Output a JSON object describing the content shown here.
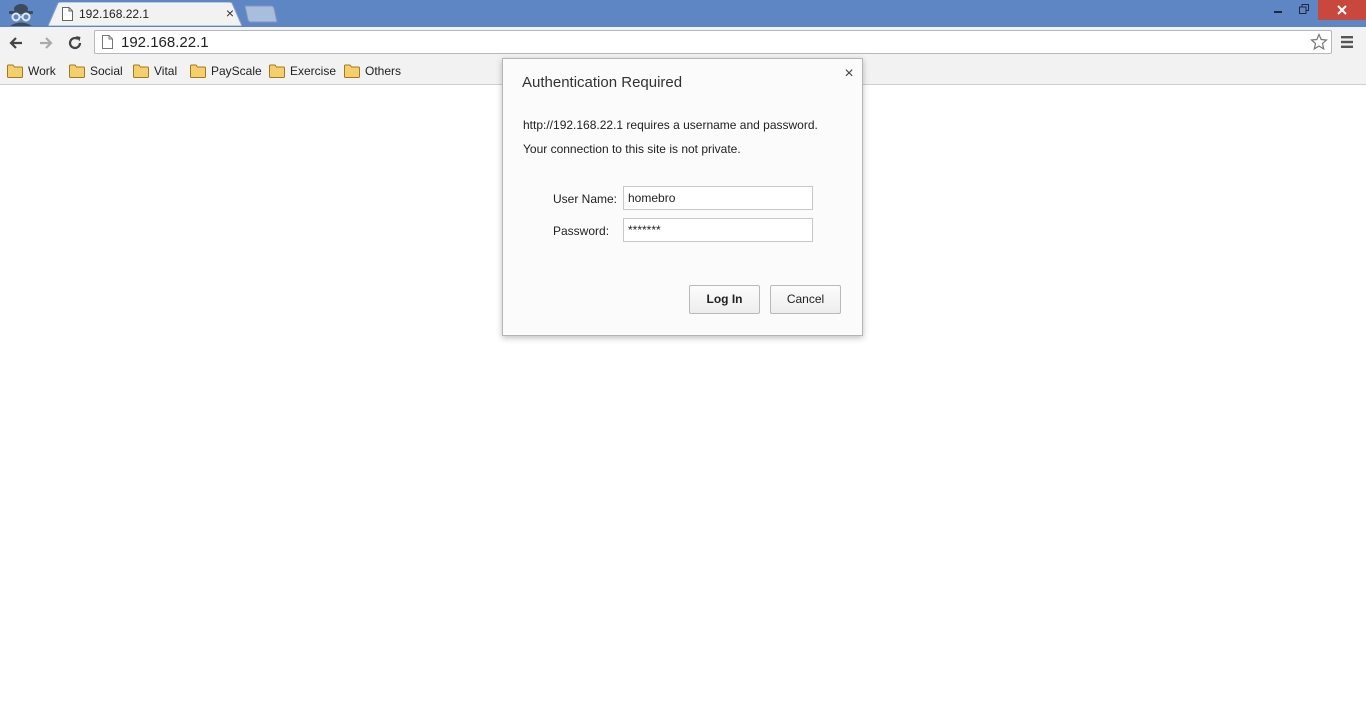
{
  "browser": {
    "tab": {
      "title": "192.168.22.1",
      "close_glyph": "×"
    },
    "url": "192.168.22.1",
    "icons": {
      "incognito": "incognito-icon",
      "back": "back-arrow-icon",
      "forward": "forward-arrow-icon",
      "reload": "reload-icon",
      "star": "star-icon",
      "menu": "hamburger-menu-icon"
    },
    "colors": {
      "titlebar": "#5f86c4",
      "close_button": "#c9483d",
      "folder": "#f5cf6b"
    }
  },
  "bookmarks": [
    {
      "label": "Work"
    },
    {
      "label": "Social"
    },
    {
      "label": "Vital"
    },
    {
      "label": "PayScale"
    },
    {
      "label": "Exercise"
    },
    {
      "label": "Others"
    }
  ],
  "dialog": {
    "title": "Authentication Required",
    "close_glyph": "×",
    "message1": "http://192.168.22.1 requires a username and password.",
    "message2": "Your connection to this site is not private.",
    "username_label": "User Name:",
    "username_value": "homebro",
    "password_label": "Password:",
    "password_value": "*******",
    "login_label": "Log In",
    "cancel_label": "Cancel"
  }
}
